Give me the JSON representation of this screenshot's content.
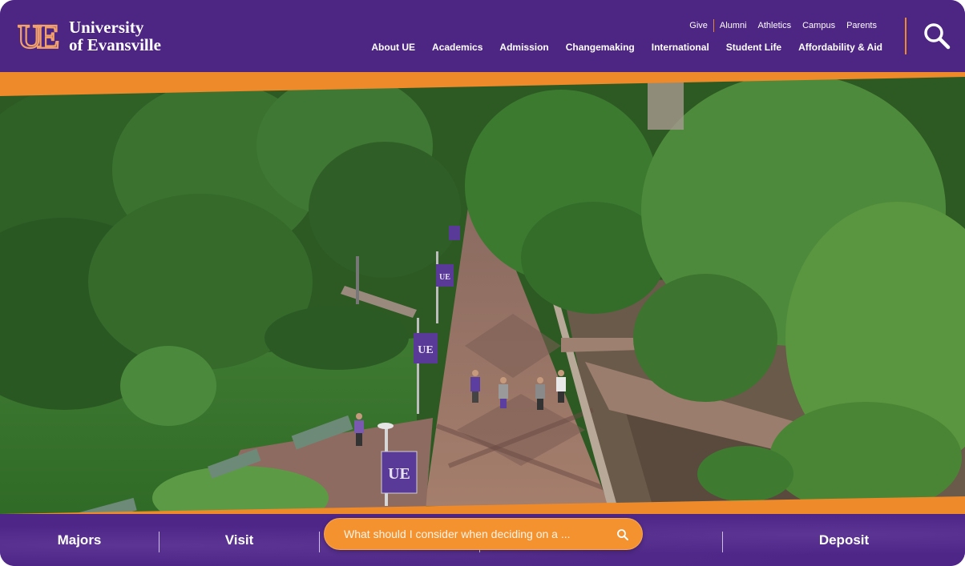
{
  "brand": {
    "line1": "University",
    "line2": "of Evansville",
    "mark": "UE"
  },
  "utility_nav": [
    {
      "label": "Give"
    },
    {
      "label": "Alumni"
    },
    {
      "label": "Athletics"
    },
    {
      "label": "Campus"
    },
    {
      "label": "Parents"
    }
  ],
  "main_nav": [
    {
      "label": "About UE"
    },
    {
      "label": "Academics"
    },
    {
      "label": "Admission"
    },
    {
      "label": "Changemaking"
    },
    {
      "label": "International"
    },
    {
      "label": "Student Life"
    },
    {
      "label": "Affordability & Aid"
    }
  ],
  "header": {
    "search_icon": "search-icon"
  },
  "hero": {
    "banner_text": "UE"
  },
  "quick_links": [
    {
      "label": "Majors"
    },
    {
      "label": "Visit"
    },
    {
      "label": "Deposit"
    }
  ],
  "ask": {
    "placeholder": "What should I consider when deciding on a ...",
    "icon": "search-icon"
  },
  "colors": {
    "purple": "#4d2583",
    "orange": "#f3922f"
  }
}
